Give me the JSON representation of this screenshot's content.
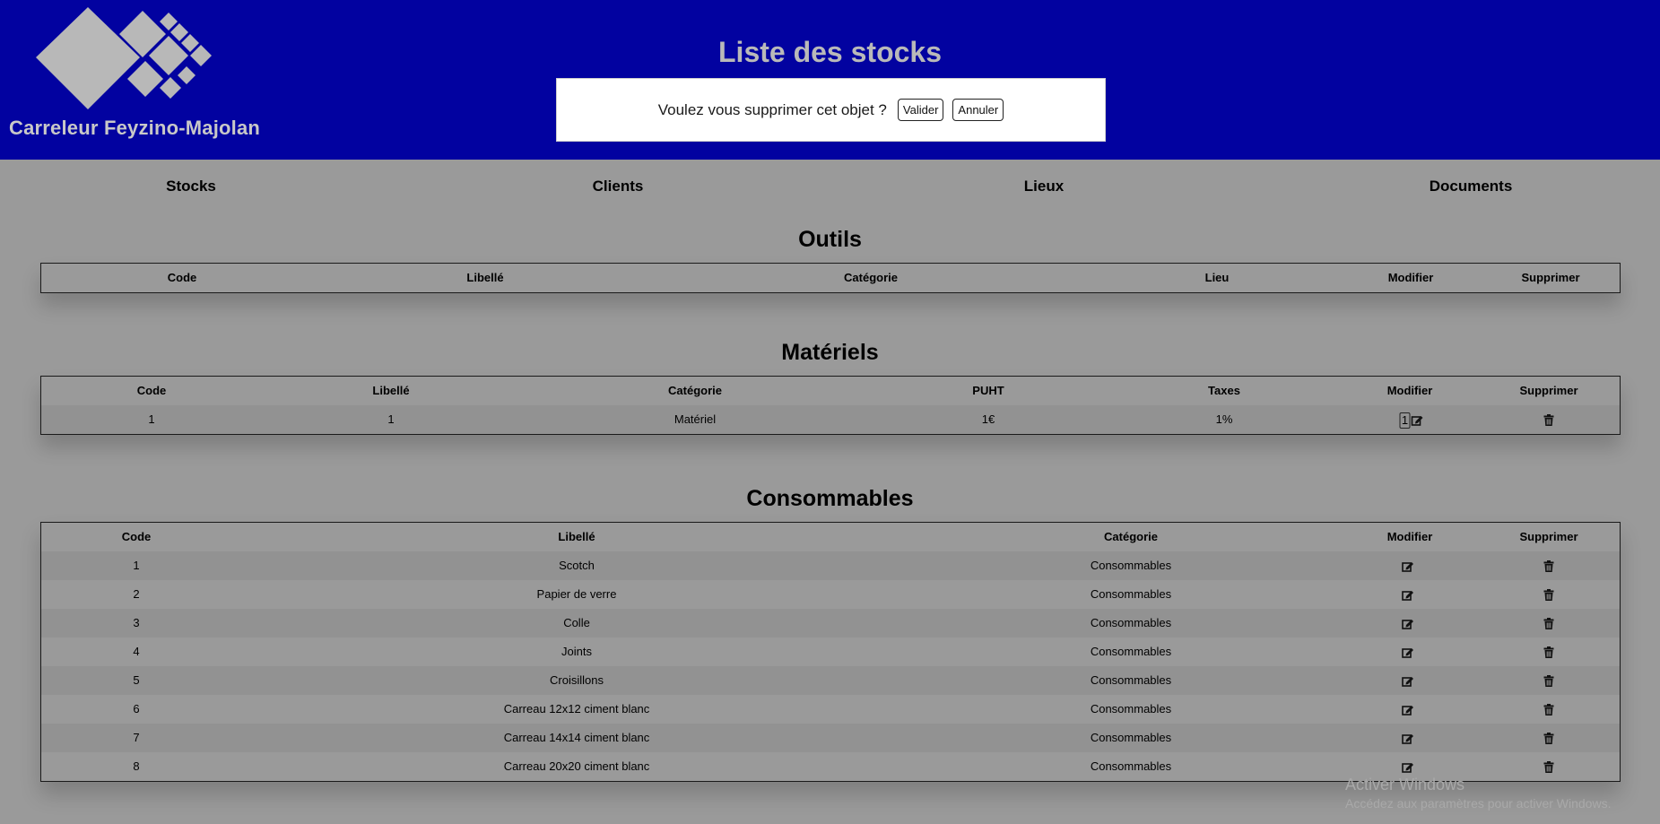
{
  "header": {
    "title": "Liste des stocks",
    "brand": "Carreleur Feyzino-Majolan",
    "bg_color": "#0202a0"
  },
  "dialog": {
    "question": "Voulez vous supprimer cet objet ?",
    "confirm_label": "Valider",
    "cancel_label": "Annuler"
  },
  "nav": {
    "items": [
      {
        "label": "Stocks"
      },
      {
        "label": "Clients"
      },
      {
        "label": "Lieux"
      },
      {
        "label": "Documents"
      }
    ]
  },
  "outils": {
    "title": "Outils",
    "columns": [
      "Code",
      "Libellé",
      "Catégorie",
      "Lieu",
      "Modifier",
      "Supprimer"
    ]
  },
  "materiels": {
    "title": "Matériels",
    "columns": [
      "Code",
      "Libellé",
      "Catégorie",
      "PUHT",
      "Taxes",
      "Modifier",
      "Supprimer"
    ],
    "rows": [
      {
        "code": "1",
        "libelle": "1",
        "categorie": "Matériel",
        "puht": "1€",
        "taxes": "1%",
        "modifier_value": "1"
      }
    ]
  },
  "consommables": {
    "title": "Consommables",
    "columns": [
      "Code",
      "Libellé",
      "Catégorie",
      "Modifier",
      "Supprimer"
    ],
    "rows": [
      {
        "code": "1",
        "libelle": "Scotch",
        "categorie": "Consommables"
      },
      {
        "code": "2",
        "libelle": "Papier de verre",
        "categorie": "Consommables"
      },
      {
        "code": "3",
        "libelle": "Colle",
        "categorie": "Consommables"
      },
      {
        "code": "4",
        "libelle": "Joints",
        "categorie": "Consommables"
      },
      {
        "code": "5",
        "libelle": "Croisillons",
        "categorie": "Consommables"
      },
      {
        "code": "6",
        "libelle": "Carreau 12x12 ciment blanc",
        "categorie": "Consommables"
      },
      {
        "code": "7",
        "libelle": "Carreau 14x14 ciment blanc",
        "categorie": "Consommables"
      },
      {
        "code": "8",
        "libelle": "Carreau 20x20 ciment blanc",
        "categorie": "Consommables"
      }
    ]
  },
  "watermark": {
    "line1": "Activer Windows",
    "line2": "Accédez aux paramètres pour activer Windows."
  },
  "icons": {
    "edit": "edit-icon",
    "delete": "trash-icon",
    "logo": "diamond-tiles-logo"
  }
}
